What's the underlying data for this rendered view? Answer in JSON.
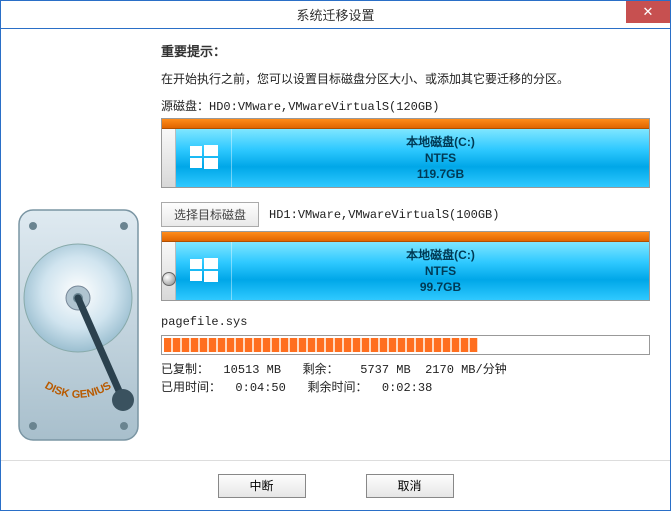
{
  "window": {
    "title": "系统迁移设置"
  },
  "heading": "重要提示：",
  "instruction": "在开始执行之前，您可以设置目标磁盘分区大小、或添加其它要迁移的分区。",
  "source": {
    "prefix": "源磁盘：",
    "desc": "HD0:VMware,VMwareVirtualS(120GB)",
    "volume_name": "本地磁盘(C:)",
    "fs": "NTFS",
    "size": "119.7GB"
  },
  "target": {
    "button": "选择目标磁盘",
    "desc": "HD1:VMware,VMwareVirtualS(100GB)",
    "volume_name": "本地磁盘(C:)",
    "fs": "NTFS",
    "size": "99.7GB"
  },
  "current_file": "pagefile.sys",
  "progress": {
    "percent": 65
  },
  "stats": {
    "copied_label": "已复制：",
    "copied_val": "10513 MB",
    "remaining_label": "剩余：",
    "remaining_val": "5737 MB",
    "rate": "2170 MB/分钟",
    "elapsed_label": "已用时间：",
    "elapsed_val": "0:04:50",
    "remaining_time_label": "剩余时间：",
    "remaining_time_val": "0:02:38"
  },
  "footer": {
    "abort": "中断",
    "cancel": "取消"
  },
  "brand": "DISK GENIUS"
}
